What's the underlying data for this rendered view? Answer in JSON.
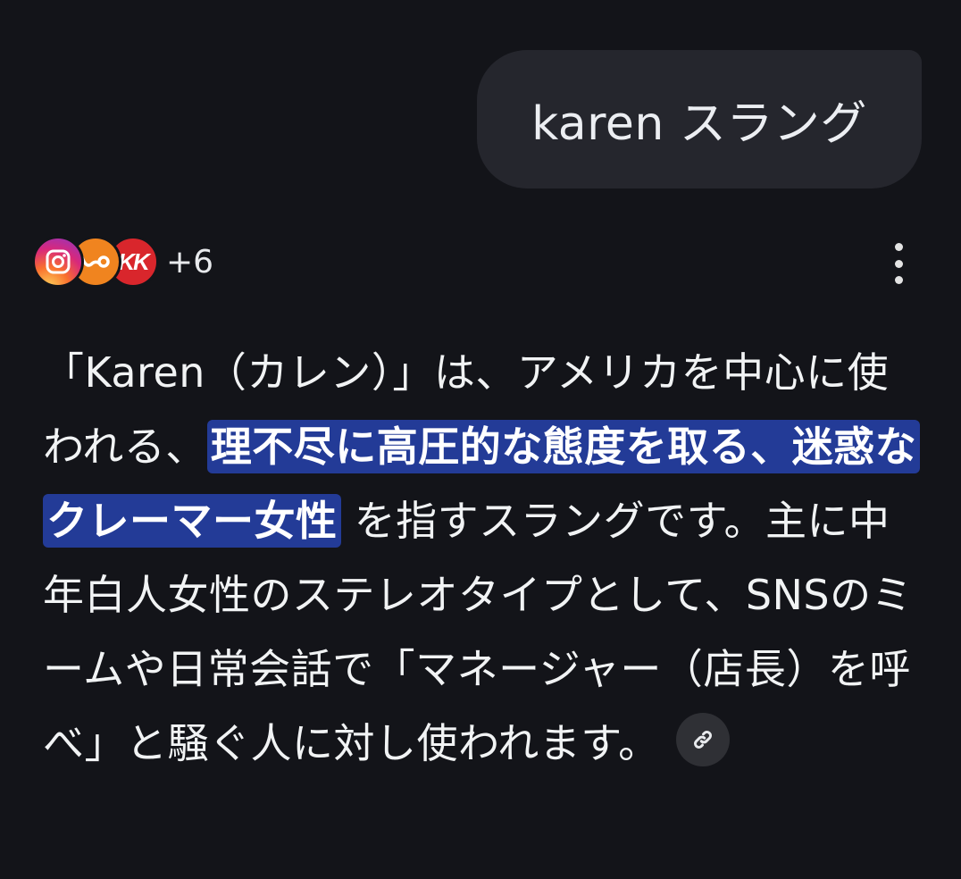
{
  "user_query": {
    "text": "karen スラング"
  },
  "sources": {
    "icons": [
      "instagram-icon",
      "orange-brand-icon",
      "red-brand-icon"
    ],
    "red_icon_text": "KK",
    "more_count": "+6"
  },
  "answer": {
    "text_before": "「Karen（カレン）」は、アメリカを中心に使われる、",
    "highlight": "理不尽に高圧的な態度を取る、迷惑なクレーマー女性",
    "text_after": "を指すスラングです。主に中年白人女性のステレオタイプとして、SNSのミームや日常会話で「マネージャー（店長）を呼べ」と騒ぐ人に対し使われます。"
  },
  "colors": {
    "background": "#131419",
    "bubble": "#25262d",
    "highlight": "#233b97",
    "text": "#f1f3f4"
  }
}
